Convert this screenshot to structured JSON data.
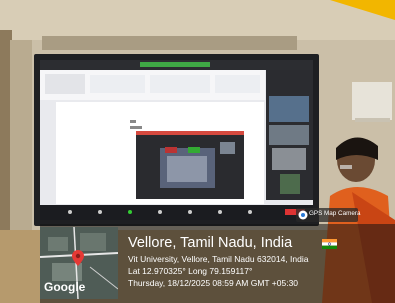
{
  "photo": {
    "description_icon": "camera-photo",
    "colors": {
      "wall": "#cfc3ad",
      "board_bezel": "#1e1f22",
      "screen_bg": "#f4f4f6",
      "overlay": "#2a2a2a",
      "accent_red": "#d64a3f",
      "saree_orange": "#e0601e"
    }
  },
  "overlay": {
    "city_line": "Vellore, Tamil Nadu, India",
    "address_line": "Vit University, Vellore, Tamil Nadu 632014, India",
    "coords_line": "Lat 12.970325° Long 79.159117°",
    "datetime_line": "Thursday, 18/12/2025 08:59 AM GMT +05:30",
    "map_label": "Google",
    "app_badge": "GPS Map Camera",
    "flag_icon": "india-flag-icon",
    "pin_icon": "map-pin-icon"
  }
}
